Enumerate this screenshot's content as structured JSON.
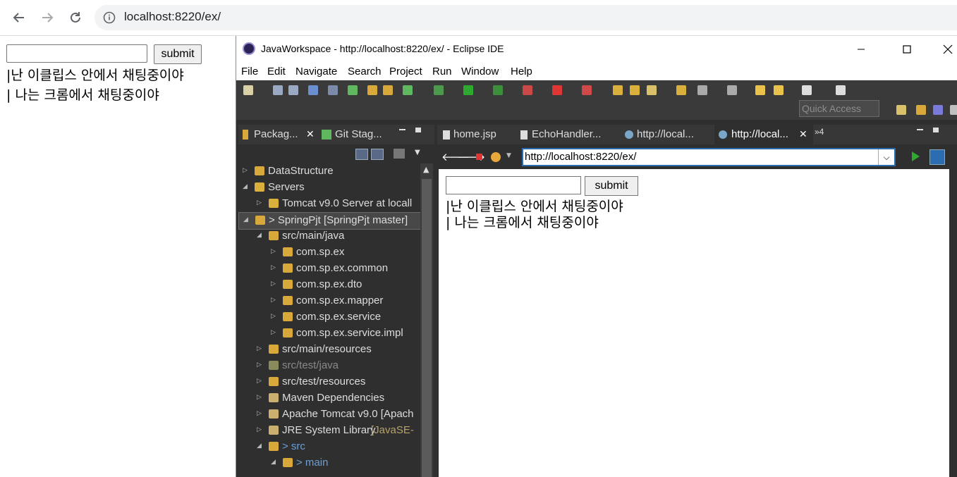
{
  "chrome": {
    "url": "localhost:8220/ex/"
  },
  "page": {
    "submit_label": "submit",
    "messages": [
      "|난 이클립스 안에서 채팅중이야",
      "| 나는 크롬에서 채팅중이야"
    ]
  },
  "eclipse": {
    "title": "JavaWorkspace - http://localhost:8220/ex/ - Eclipse IDE",
    "menu": [
      "File",
      "Edit",
      "Navigate",
      "Search",
      "Project",
      "Run",
      "Window",
      "Help"
    ],
    "quick_access": "Quick Access",
    "explorer": {
      "tabs": [
        "Packag...",
        "Git Stag..."
      ],
      "tree": [
        {
          "label": "DataStructure",
          "twisty": "▷"
        },
        {
          "label": "Servers",
          "twisty": "◢"
        },
        {
          "label": "Tomcat v9.0 Server at locall",
          "twisty": "▷"
        },
        {
          "label": "> SpringPjt [SpringPjt master]",
          "twisty": "◢"
        },
        {
          "label": "src/main/java",
          "twisty": "◢"
        },
        {
          "label": "com.sp.ex",
          "twisty": "▷"
        },
        {
          "label": "com.sp.ex.common",
          "twisty": "▷"
        },
        {
          "label": "com.sp.ex.dto",
          "twisty": "▷"
        },
        {
          "label": "com.sp.ex.mapper",
          "twisty": "▷"
        },
        {
          "label": "com.sp.ex.service",
          "twisty": "▷"
        },
        {
          "label": "com.sp.ex.service.impl",
          "twisty": "▷"
        },
        {
          "label": "src/main/resources",
          "twisty": "▷"
        },
        {
          "label": "src/test/java",
          "twisty": "▷"
        },
        {
          "label": "src/test/resources",
          "twisty": "▷"
        },
        {
          "label": "Maven Dependencies",
          "twisty": "▷"
        },
        {
          "label": "Apache Tomcat v9.0 [Apach",
          "twisty": "▷"
        },
        {
          "label": "JRE System Library",
          "suffix": " [JavaSE-",
          "twisty": "▷"
        },
        {
          "label": "> src",
          "twisty": "◢"
        },
        {
          "label": "> main",
          "twisty": "◢"
        }
      ]
    },
    "editor": {
      "tabs": [
        "home.jsp",
        "EchoHandler...",
        "http://local...",
        "http://local..."
      ],
      "overflow": "»4",
      "url": "http://localhost:8220/ex/",
      "submit_label": "submit",
      "messages": [
        "|난 이클립스 안에서 채팅중이야",
        "| 나는 크롬에서 채팅중이야"
      ]
    }
  },
  "colors": {
    "eclipse_dark": "#2f2f2f",
    "url_border": "#2b6bb0",
    "link_blue": "#6aa0d8"
  }
}
